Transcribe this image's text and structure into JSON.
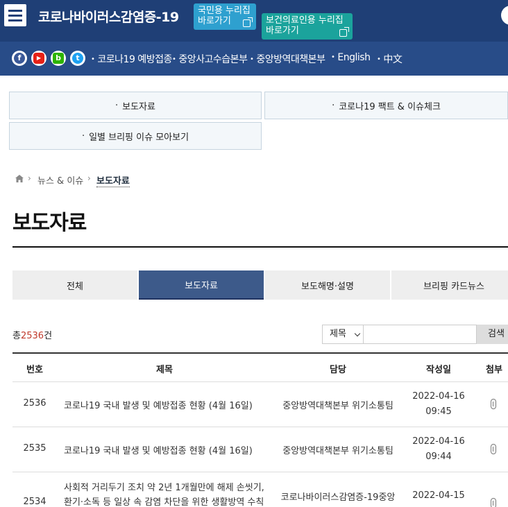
{
  "header": {
    "site_title": "코로나바이러스감염증-19",
    "quick_buttons": [
      {
        "label": "국민용 누리집 바로가기"
      },
      {
        "label": "보건의료인용 누리집 바로가기"
      }
    ]
  },
  "sub_nav": {
    "sns": [
      {
        "name": "facebook",
        "glyph": "f"
      },
      {
        "name": "youtube",
        "glyph": "▶"
      },
      {
        "name": "blog",
        "glyph": "b"
      },
      {
        "name": "twitter",
        "glyph": "t"
      }
    ],
    "links": [
      "코로나19 예방접종",
      "중앙사고수습본부",
      "중앙방역대책본부",
      "English",
      "中文"
    ]
  },
  "shortcuts": [
    "보도자료",
    "코로나19 팩트 & 이슈체크",
    "일별 브리핑 이슈 모아보기"
  ],
  "breadcrumb": {
    "items": [
      "뉴스 & 이슈",
      "보도자료"
    ]
  },
  "page_title": "보도자료",
  "tabs": [
    {
      "label": "전체",
      "active": false
    },
    {
      "label": "보도자료",
      "active": true
    },
    {
      "label": "보도해명·설명",
      "active": false
    },
    {
      "label": "브리핑 카드뉴스",
      "active": false
    }
  ],
  "search": {
    "total_prefix": "총",
    "total_count": "2536",
    "total_suffix": "건",
    "select_value": "제목",
    "input_value": "",
    "button_label": "검색"
  },
  "table": {
    "headers": [
      "번호",
      "제목",
      "담당",
      "작성일",
      "첨부"
    ],
    "rows": [
      {
        "no": "2536",
        "title": "코로나19 국내 발생 및 예방접종 현황 (4월 16일)",
        "dept": "중앙방역대책본부 위기소통팀",
        "date": "2022-04-16",
        "time": "09:45"
      },
      {
        "no": "2535",
        "title": "코로나19 국내 발생 및 예방접종 현황 (4월 16일)",
        "dept": "중앙방역대책본부 위기소통팀",
        "date": "2022-04-16",
        "time": "09:44"
      },
      {
        "no": "2534",
        "title": "사회적 거리두기 조치 약 2년 1개월만에 해제 손씻기, 환기·소독 등 일상 속 감염 차단을 위한 생활방역 수칙",
        "dept": "코로나바이러스감염증-19중앙",
        "date": "2022-04-15",
        "time": ""
      }
    ]
  },
  "colors": {
    "header_bg": "#1f3f76",
    "subnav_bg": "#284c88",
    "active_tab": "#3d5a8a",
    "count_red": "#c0392b"
  }
}
